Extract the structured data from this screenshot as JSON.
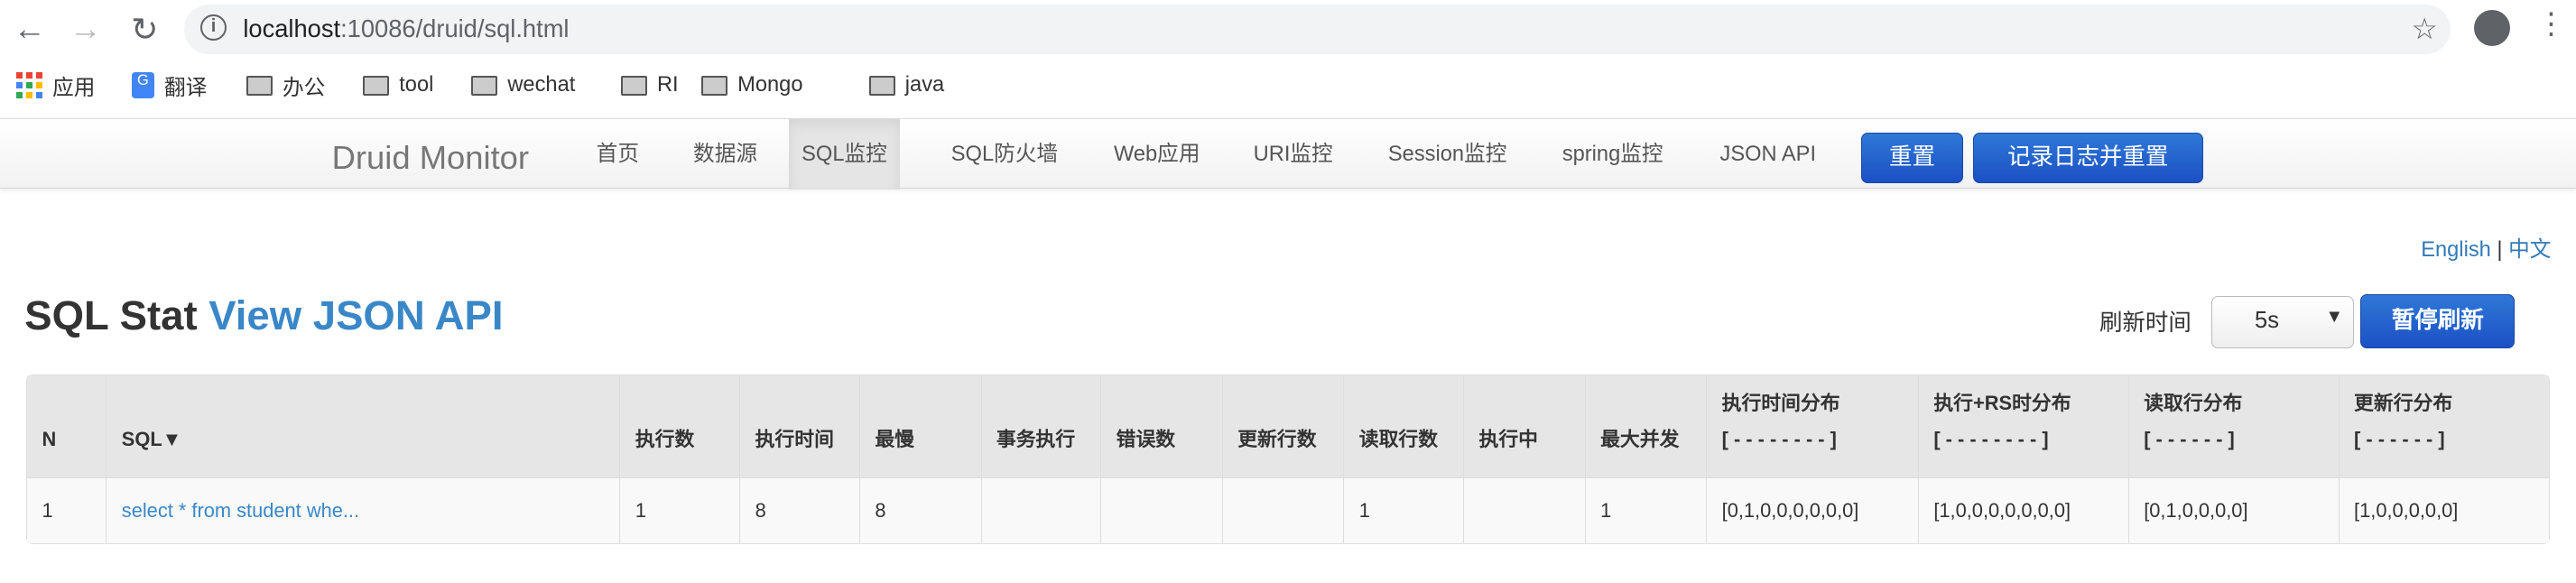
{
  "browser": {
    "url_host": "localhost",
    "url_path": ":10086/druid/sql.html",
    "bookmarks": [
      "应用",
      "翻译",
      "办公",
      "tool",
      "wechat",
      "RI",
      "Mongo",
      "java"
    ]
  },
  "nav": {
    "brand": "Druid Monitor",
    "items": [
      "首页",
      "数据源",
      "SQL监控",
      "SQL防火墙",
      "Web应用",
      "URI监控",
      "Session监控",
      "spring监控",
      "JSON API"
    ],
    "active": "SQL监控",
    "reset": "重置",
    "log_reset": "记录日志并重置"
  },
  "lang": {
    "en": "English",
    "sep": "|",
    "zh": "中文"
  },
  "title": {
    "main": "SQL Stat",
    "link": "View JSON API"
  },
  "refresh": {
    "label": "刷新时间",
    "value": "5s",
    "pause": "暂停刷新"
  },
  "table": {
    "headers": [
      "N",
      "SQL▼",
      "执行数",
      "执行时间",
      "最慢",
      "事务执行",
      "错误数",
      "更新行数",
      "读取行数",
      "执行中",
      "最大并发",
      "执行时间分布",
      "执行+RS时分布",
      "读取行分布",
      "更新行分布"
    ],
    "header_sub": {
      "11": "[ - - - - - - - - ]",
      "12": "[ - - - - - - - - ]",
      "13": "[ - - - - - - ]",
      "14": "[ - - - - - - ]"
    },
    "rows": [
      [
        "1",
        "select * from student whe...",
        "1",
        "8",
        "8",
        "",
        "",
        "",
        "1",
        "",
        "1",
        "[0,1,0,0,0,0,0,0]",
        "[1,0,0,0,0,0,0,0]",
        "[0,1,0,0,0,0]",
        "[1,0,0,0,0,0]"
      ]
    ]
  },
  "colors": {
    "accent": "#3a87c8",
    "button": "#1b50c4"
  }
}
